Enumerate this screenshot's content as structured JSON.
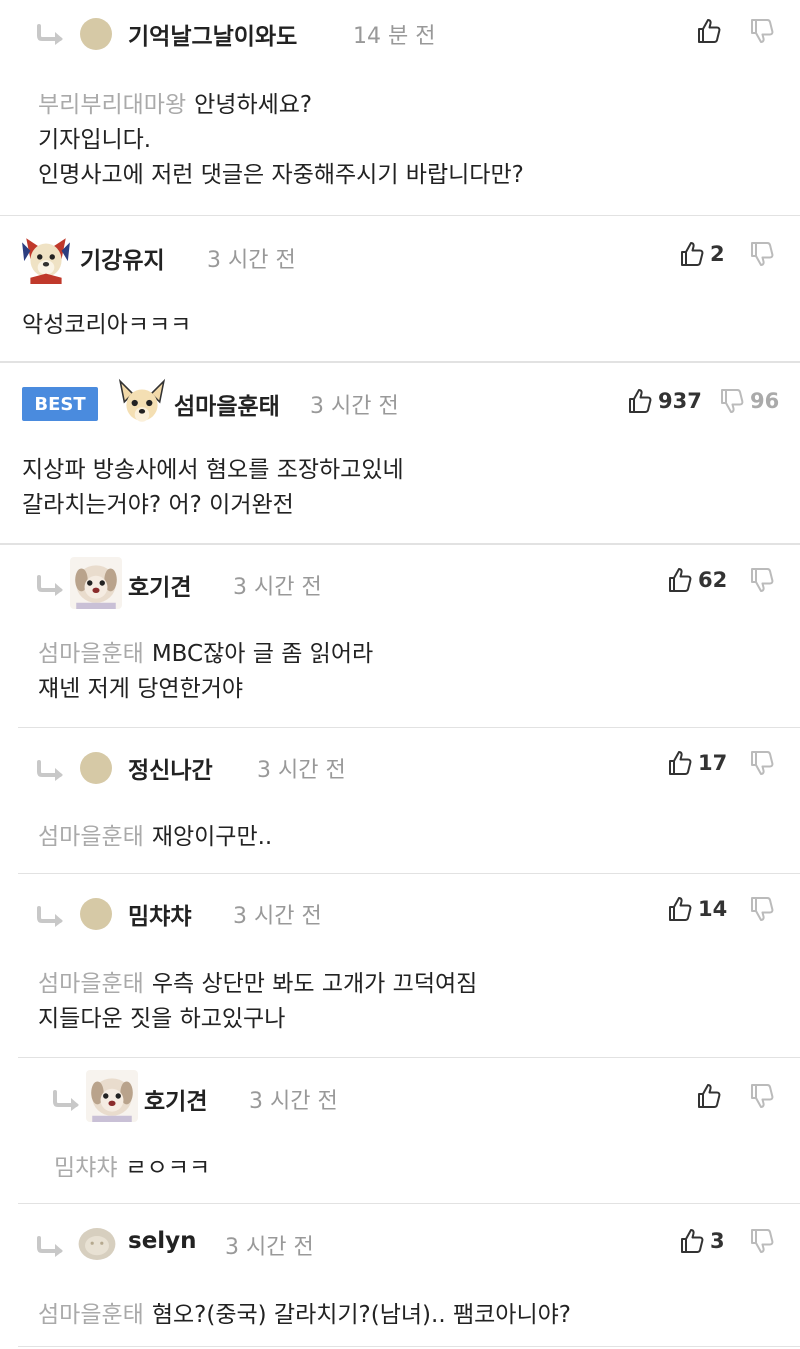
{
  "comments": [
    {
      "name": "기억날그날이와도",
      "time": "14 분 전",
      "mention": "부리부리대마왕",
      "lines": [
        "안녕하세요?",
        "기자입니다.",
        "인명사고에 저런 댓글은 자중해주시기 바랍니다만?"
      ],
      "likes": "",
      "dislikes": ""
    },
    {
      "name": "기강유지",
      "time": "3 시간 전",
      "lines": [
        "악성코리아ㅋㅋㅋ"
      ],
      "likes": "2",
      "dislikes": ""
    },
    {
      "badge": "BEST",
      "name": "섬마을훈태",
      "time": "3 시간 전",
      "lines": [
        "지상파 방송사에서 혐오를 조장하고있네",
        "갈라치는거야? 어? 이거완전"
      ],
      "likes": "937",
      "dislikes": "96"
    },
    {
      "name": "호기견",
      "time": "3 시간 전",
      "mention": "섬마을훈태",
      "lines": [
        "MBC잖아 글 좀 읽어라",
        "쟤넨 저게 당연한거야"
      ],
      "likes": "62",
      "dislikes": ""
    },
    {
      "name": "정신나간",
      "time": "3 시간 전",
      "mention": "섬마을훈태",
      "lines": [
        "재앙이구만.."
      ],
      "likes": "17",
      "dislikes": ""
    },
    {
      "name": "밈챠챠",
      "time": "3 시간 전",
      "mention": "섬마을훈태",
      "lines": [
        "우측 상단만 봐도 고개가 끄덕여짐",
        "지들다운 짓을 하고있구나"
      ],
      "likes": "14",
      "dislikes": ""
    },
    {
      "name": "호기견",
      "time": "3 시간 전",
      "mention": "밈챠챠",
      "lines": [
        "ㄹㅇㅋㅋ"
      ],
      "likes": "",
      "dislikes": ""
    },
    {
      "name": "selyn",
      "time": "3 시간 전",
      "mention": "섬마을훈태",
      "lines": [
        "혐오?(중국) 갈라치기?(남녀).. 팸코아니야?"
      ],
      "likes": "3",
      "dislikes": ""
    }
  ],
  "icons": {
    "reply": "reply-arrow-icon",
    "like": "thumbs-up-icon",
    "dislike": "thumbs-down-icon"
  },
  "colors": {
    "best_badge": "#4a8bde",
    "name": "#222222",
    "time": "#999999",
    "mention": "#aaaaaa",
    "divider": "#e2e2e2"
  }
}
